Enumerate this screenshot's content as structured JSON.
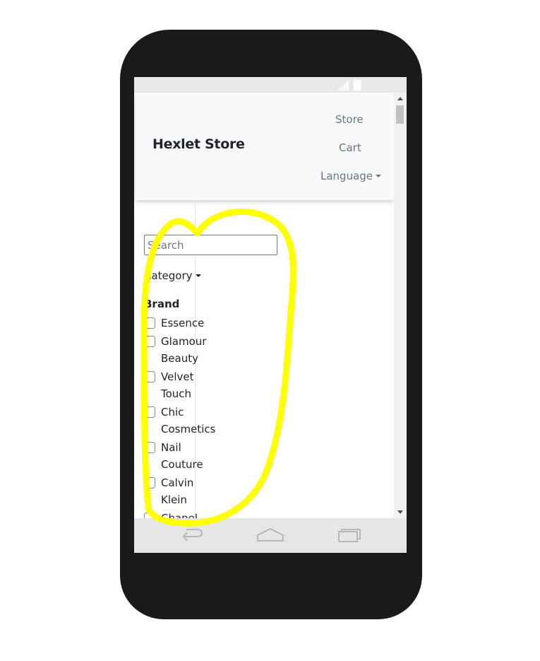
{
  "device": {
    "type": "android-phone",
    "body_color": "#1a1a1a",
    "status_bar": {
      "icons": [
        "signal-icon",
        "battery-icon"
      ]
    },
    "nav_bar": {
      "icons": [
        "back-icon",
        "home-icon",
        "recent-apps-icon"
      ]
    }
  },
  "navbar": {
    "brand": "Hexlet Store",
    "links": {
      "store": "Store",
      "cart": "Cart",
      "language": "Language"
    }
  },
  "filters": {
    "search_placeholder": "Search",
    "search_value": "",
    "category_label": "Category",
    "brand_heading": "Brand",
    "brands": [
      {
        "label": "Essence",
        "checked": false
      },
      {
        "label": "Glamour Beauty",
        "checked": false
      },
      {
        "label": "Velvet Touch",
        "checked": false
      },
      {
        "label": "Chic Cosmetics",
        "checked": false
      },
      {
        "label": "Nail Couture",
        "checked": false
      },
      {
        "label": "Calvin Klein",
        "checked": false
      },
      {
        "label": "Chanel",
        "checked": false
      }
    ]
  },
  "annotation": {
    "type": "freehand-highlight-outline",
    "color": "#ffff00"
  }
}
